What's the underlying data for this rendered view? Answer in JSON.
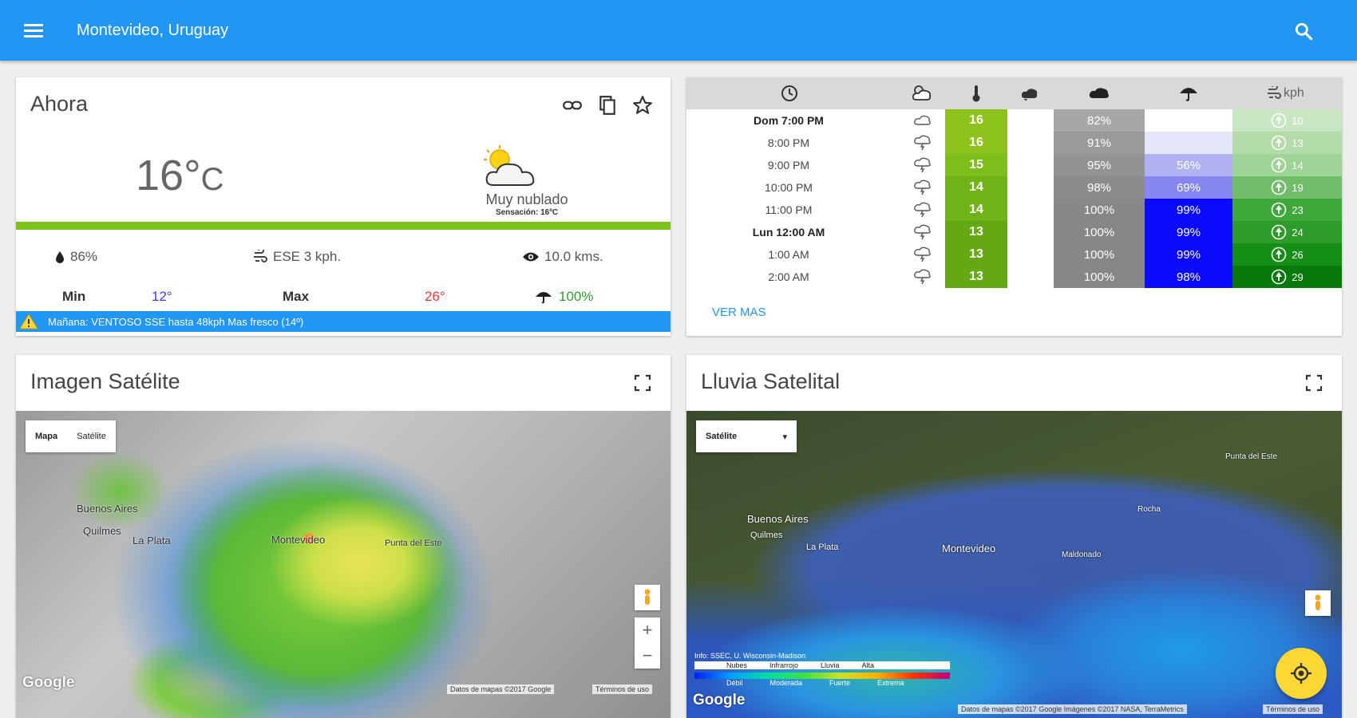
{
  "appbar": {
    "title": "Montevideo, Uruguay"
  },
  "now": {
    "title": "Ahora",
    "temp": "16°",
    "unit": "C",
    "description": "Muy nublado",
    "sensation": "Sensación: 16ºC",
    "humidity": "86%",
    "wind": "ESE 3 kph.",
    "visibility": "10.0 kms.",
    "min_label": "Min",
    "min_value": "12°",
    "max_label": "Max",
    "max_value": "26°",
    "rain_chance": "100%",
    "alert": "Mañana: VENTOSO SSE hasta 48kph Mas fresco (14º)"
  },
  "forecast": {
    "wind_unit": "kph",
    "more_label": "VER MAS",
    "rows": [
      {
        "time": "Dom 7:00 PM",
        "bold": true,
        "temp": "16",
        "temp_color": "#8dc21d",
        "cloud": "82%",
        "cloud_color": "#a7a7a7",
        "rain": "",
        "rain_color": "#ffffff",
        "wind": "10",
        "wind_color": "#c9e6c3"
      },
      {
        "time": "8:00 PM",
        "bold": false,
        "temp": "16",
        "temp_color": "#8dc21d",
        "cloud": "91%",
        "cloud_color": "#9a9a9a",
        "rain": "",
        "rain_color": "#e6e6fb",
        "wind": "13",
        "wind_color": "#b3dcaa"
      },
      {
        "time": "9:00 PM",
        "bold": false,
        "temp": "15",
        "temp_color": "#7cbe1a",
        "cloud": "95%",
        "cloud_color": "#939393",
        "rain": "56%",
        "rain_color": "#b1b1f4",
        "wind": "14",
        "wind_color": "#9fd497"
      },
      {
        "time": "10:00 PM",
        "bold": false,
        "temp": "14",
        "temp_color": "#6fb317",
        "cloud": "98%",
        "cloud_color": "#8c8c8c",
        "rain": "69%",
        "rain_color": "#8686f0",
        "wind": "19",
        "wind_color": "#72bd6a"
      },
      {
        "time": "11:00 PM",
        "bold": false,
        "temp": "14",
        "temp_color": "#6fb317",
        "cloud": "100%",
        "cloud_color": "#878787",
        "rain": "99%",
        "rain_color": "#0a0aff",
        "wind": "23",
        "wind_color": "#3ea83a"
      },
      {
        "time": "Lun 12:00 AM",
        "bold": true,
        "temp": "13",
        "temp_color": "#62a914",
        "cloud": "100%",
        "cloud_color": "#878787",
        "rain": "99%",
        "rain_color": "#0a0aff",
        "wind": "24",
        "wind_color": "#2e9c2a"
      },
      {
        "time": "1:00 AM",
        "bold": false,
        "temp": "13",
        "temp_color": "#62a914",
        "cloud": "100%",
        "cloud_color": "#878787",
        "rain": "99%",
        "rain_color": "#0a0aff",
        "wind": "26",
        "wind_color": "#168f16"
      },
      {
        "time": "2:00 AM",
        "bold": false,
        "temp": "13",
        "temp_color": "#62a914",
        "cloud": "100%",
        "cloud_color": "#878787",
        "rain": "98%",
        "rain_color": "#0a0aff",
        "wind": "29",
        "wind_color": "#087a0c"
      }
    ]
  },
  "satellite": {
    "title": "Imagen Satélite",
    "type_map": "Mapa",
    "type_sat": "Satélite",
    "cities": [
      "Buenos Aires",
      "Quilmes",
      "La Plata",
      "Montevideo",
      "Punta del Este"
    ],
    "google": "Google",
    "attribution": "Datos de mapas ©2017 Google",
    "terms": "Términos de uso"
  },
  "rain_sat": {
    "title": "Lluvia Satelital",
    "select_value": "Satélite",
    "cities": [
      "Buenos Aires",
      "Quilmes",
      "La Plata",
      "Montevideo",
      "Punta del Este",
      "Rocha",
      "Maldonado"
    ],
    "legend_info": "Info: SSEC, U. Wisconsin-Madison",
    "legend_labels": [
      "Nubes",
      "Infrarrojo",
      "Lluvia",
      "Alta"
    ],
    "legend_scale": [
      "Débil",
      "Moderada",
      "Fuerte",
      "Extrema"
    ],
    "google": "Google",
    "attribution": "Datos de mapas ©2017 Google Imágenes ©2017 NASA, TerraMetrics",
    "terms": "Términos de uso"
  },
  "colors": {
    "appbar": "#2196f3",
    "green_bar": "#7cc21d",
    "alert": "#2196f3",
    "fab": "#fdd835"
  }
}
